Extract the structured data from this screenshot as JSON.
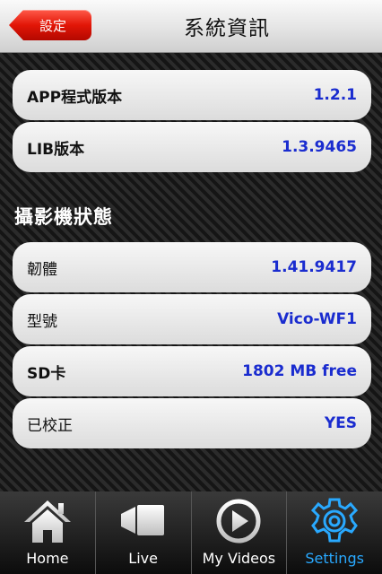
{
  "navbar": {
    "back_label": "設定",
    "title": "系統資訊"
  },
  "app_info": [
    {
      "label": "APP程式版本",
      "value": "1.2.1"
    },
    {
      "label": "LIB版本",
      "value": "1.3.9465"
    }
  ],
  "camera_section": {
    "header": "攝影機狀態",
    "rows": [
      {
        "label": "韌體",
        "value": "1.41.9417"
      },
      {
        "label": "型號",
        "value": "Vico-WF1"
      },
      {
        "label": "SD卡",
        "value": "1802 MB free"
      },
      {
        "label": "已校正",
        "value": "YES"
      }
    ]
  },
  "tabbar": {
    "tabs": [
      {
        "label": "Home",
        "icon": "home-icon"
      },
      {
        "label": "Live",
        "icon": "video-camera-icon"
      },
      {
        "label": "My Videos",
        "icon": "play-icon"
      },
      {
        "label": "Settings",
        "icon": "gear-icon"
      }
    ],
    "active_color": "#29a9ff"
  },
  "colors": {
    "value_blue": "#1a2ccf",
    "back_red": "#e21607"
  }
}
